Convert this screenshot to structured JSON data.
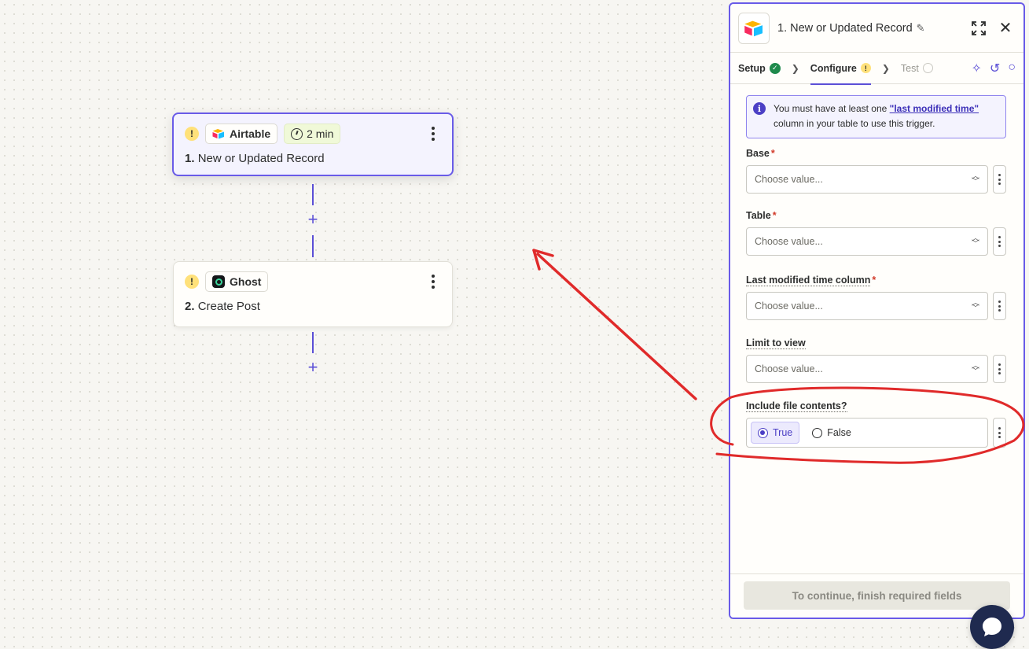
{
  "canvas": {
    "nodes": [
      {
        "warning": "!",
        "app": "Airtable",
        "time": "2 min",
        "step": "1.",
        "title": "New or Updated Record"
      },
      {
        "warning": "!",
        "app": "Ghost",
        "step": "2.",
        "title": "Create Post"
      }
    ],
    "add_step": "+"
  },
  "panel": {
    "title": "1. New or Updated Record",
    "tabs": [
      {
        "label": "Setup",
        "status": "complete"
      },
      {
        "label": "Configure",
        "status": "warning"
      },
      {
        "label": "Test",
        "status": "pending"
      }
    ],
    "info": {
      "prefix": "You must have at least one ",
      "link": "\"last modified time\"",
      "suffix": " column in your table to use this trigger."
    },
    "fields": [
      {
        "label": "Base",
        "required": true,
        "placeholder": "Choose value..."
      },
      {
        "label": "Table",
        "required": true,
        "placeholder": "Choose value..."
      },
      {
        "label": "Last modified time column",
        "required": true,
        "placeholder": "Choose value..."
      },
      {
        "label": "Limit to view",
        "required": false,
        "placeholder": "Choose value..."
      }
    ],
    "file_contents": {
      "label": "Include file contents?",
      "options": [
        "True",
        "False"
      ],
      "selected": "True"
    },
    "continue_label": "To continue, finish required fields"
  },
  "colors": {
    "accent": "#695be8",
    "annotation": "#e02a2a",
    "warning": "#ffe17a",
    "success": "#1f8a4c"
  },
  "icons": [
    "warning-icon",
    "airtable-logo-icon",
    "clock-icon",
    "ghost-logo-icon",
    "kebab-menu-icon",
    "pencil-icon",
    "expand-icon",
    "close-icon",
    "check-icon",
    "chevron-right-icon",
    "sparkle-icon",
    "undo-icon",
    "comment-icon",
    "info-icon",
    "updown-chevron-icon",
    "chat-icon"
  ]
}
